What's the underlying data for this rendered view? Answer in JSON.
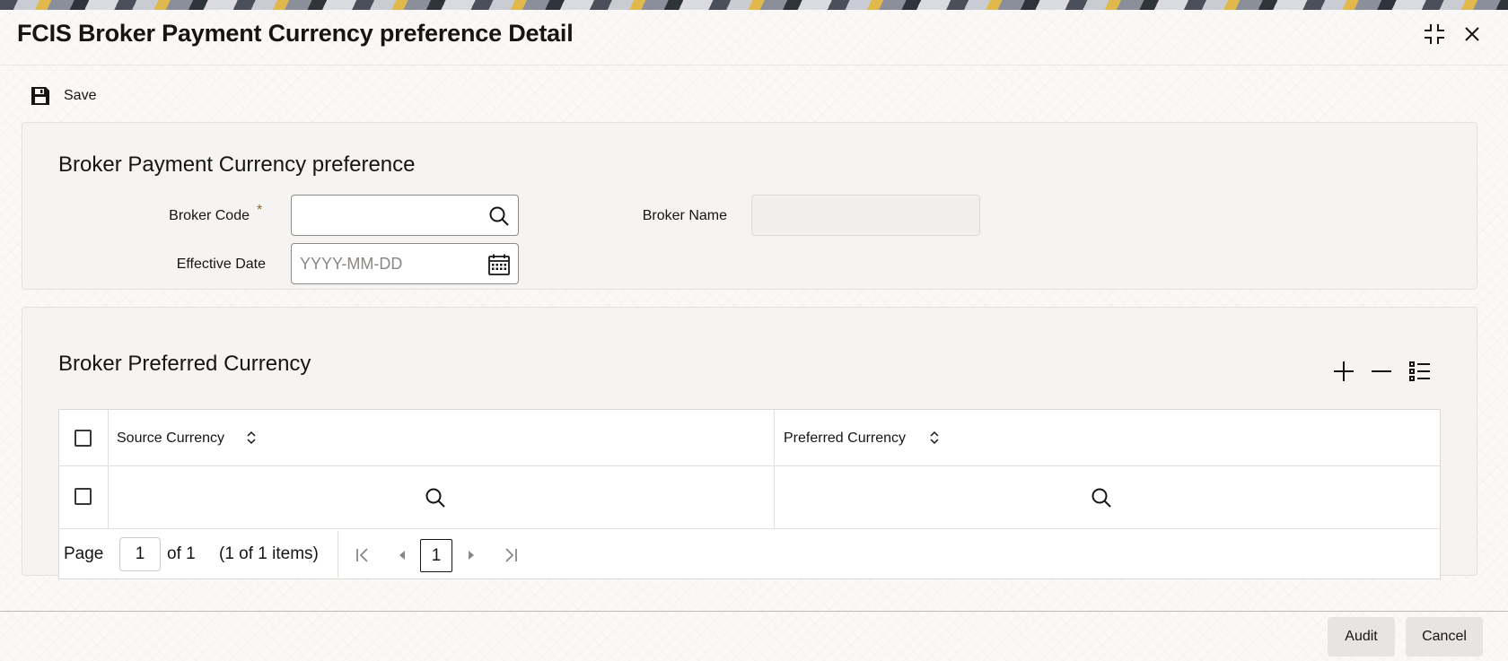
{
  "window": {
    "title": "FCIS Broker Payment Currency preference Detail"
  },
  "toolbar": {
    "save_label": "Save"
  },
  "header_section": {
    "title": "Broker Payment Currency preference",
    "broker_code": {
      "label": "Broker Code",
      "required_marker": "*",
      "value": ""
    },
    "broker_name": {
      "label": "Broker Name",
      "value": ""
    },
    "effective_date": {
      "label": "Effective Date",
      "value": "",
      "placeholder": "YYYY-MM-DD"
    }
  },
  "currency_section": {
    "title": "Broker Preferred Currency",
    "columns": [
      "Source Currency",
      "Preferred Currency"
    ],
    "rows": [
      {
        "source_currency": "",
        "preferred_currency": ""
      }
    ]
  },
  "pagination": {
    "page_label": "Page",
    "page_value": "1",
    "of_label": "of 1",
    "items_label": "(1 of 1 items)",
    "current_page": "1"
  },
  "footer": {
    "audit_label": "Audit",
    "cancel_label": "Cancel"
  },
  "colors": {
    "background": "#fbf9f8",
    "panel": "#f5f4f2",
    "text": "#161513",
    "button": "#e7e4e1"
  }
}
